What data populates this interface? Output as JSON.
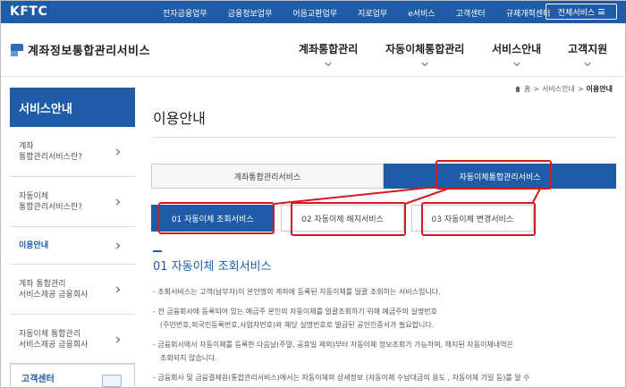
{
  "topbar": {
    "logo": "KFTC",
    "nav": [
      "전자금융업무",
      "금융정보업무",
      "어음교환업무",
      "지로업무",
      "e서비스",
      "고객센터",
      "규제개혁센터"
    ],
    "all_services": "전체서비스"
  },
  "header": {
    "brand": "계좌정보통합관리서비스",
    "menu": [
      "계좌통합관리",
      "자동이체통합관리",
      "서비스안내",
      "고객지원"
    ]
  },
  "breadcrumb": {
    "home": "홈",
    "section": "서비스안내",
    "current": "이용안내",
    "sep": ">"
  },
  "sidebar": {
    "title": "서비스안내",
    "items": [
      {
        "label": "계좌\n통합관리서비스란?"
      },
      {
        "label": "자동이체\n통합관리서비스란?"
      },
      {
        "label": "이용안내"
      },
      {
        "label": "계좌 통합관리\n서비스제공 금융회사"
      },
      {
        "label": "자동이체 통합관리\n서비스제공 금융회사"
      }
    ],
    "center": "고객센터"
  },
  "main": {
    "title": "이용안내",
    "tabs": [
      "계좌통합관리서비스",
      "자동이체통합관리서비스"
    ],
    "subtabs": [
      "01 자동이체 조회서비스",
      "02 자동이체 해지서비스",
      "03 자동이체 변경서비스"
    ],
    "section_title": "01 자동이체 조회서비스",
    "paragraphs": [
      "- 조회서비스는 고객(납부자)이 본인명의 계좌에 등록된 자동이체를 일괄 조회하는 서비스입니다.",
      "- 전 금융회사에 등록되어 있는 예금주 본인의 자동이체를 일괄조회하기 위해 예금주의 실명번호\n(주민번호,외국인등록번호,사업자번호)와 해당 실명번호로 발급된 공인인증서가 필요합니다.",
      "- 금융회사에서 자동이체를 등록한 다음날(주말, 공휴일 제외)부터 자동이체 정보조회가 가능하며, 해지된 자동이체내역은\n조회되지 않습니다.",
      "- 금융회사 및 금융결제원(통합관리서비스)에서는 자동이체의 상세정보 (자동이체 수납대금의 용도 , 자동이체 기일 등)를 알 수"
    ]
  },
  "colors": {
    "primary": "#1f5ca8",
    "annotation": "#d9171e"
  }
}
